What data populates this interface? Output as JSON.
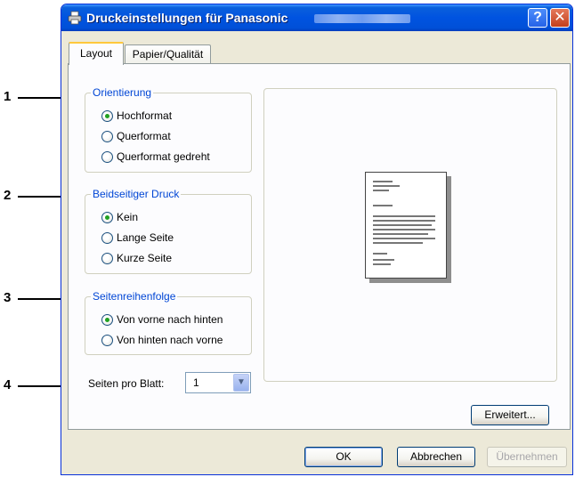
{
  "annotations": [
    "1",
    "2",
    "3",
    "4"
  ],
  "window": {
    "title": "Druckeinstellungen für Panasonic",
    "help_label": "?",
    "close_label": "✕"
  },
  "tabs": [
    {
      "label": "Layout",
      "active": true
    },
    {
      "label": "Papier/Qualität",
      "active": false
    }
  ],
  "orientation": {
    "label": "Orientierung",
    "options": [
      {
        "label": "Hochformat",
        "checked": true
      },
      {
        "label": "Querformat",
        "checked": false
      },
      {
        "label": "Querformat gedreht",
        "checked": false
      }
    ]
  },
  "duplex": {
    "label": "Beidseitiger Druck",
    "options": [
      {
        "label": "Kein",
        "checked": true
      },
      {
        "label": "Lange Seite",
        "checked": false
      },
      {
        "label": "Kurze Seite",
        "checked": false
      }
    ]
  },
  "page_order": {
    "label": "Seitenreihenfolge",
    "options": [
      {
        "label": "Von vorne nach hinten",
        "checked": true
      },
      {
        "label": "Von hinten nach vorne",
        "checked": false
      }
    ]
  },
  "pages_per_sheet": {
    "label": "Seiten pro Blatt:",
    "value": "1"
  },
  "buttons": {
    "advanced": "Erweitert...",
    "ok": "OK",
    "cancel": "Abbrechen",
    "apply": "Übernehmen"
  },
  "colors": {
    "titlebar": "#0053e0",
    "group_label": "#0046d5",
    "radio_dot": "#21a121",
    "dialog_bg": "#ece9d8"
  }
}
